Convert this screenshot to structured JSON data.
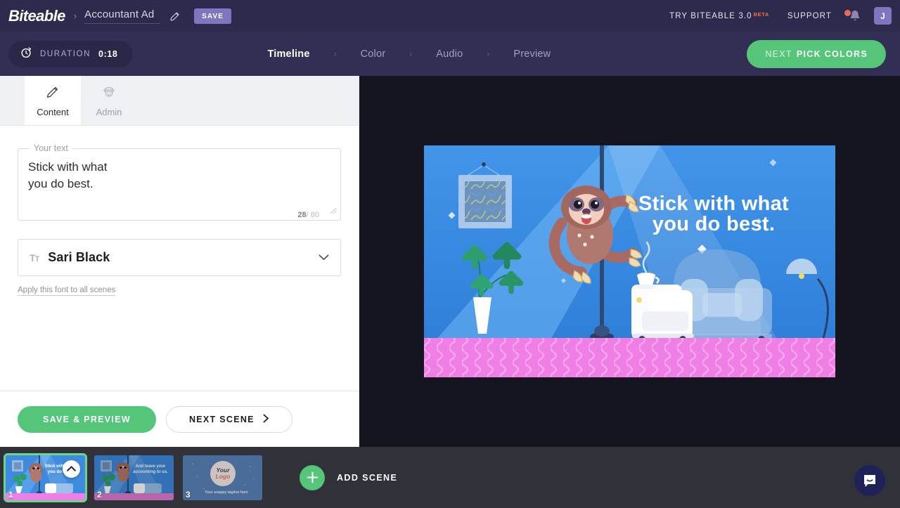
{
  "topbar": {
    "brand": "Biteable",
    "crumb_separator": "›",
    "project_name": "Accountant Ad",
    "edit_icon": "pencil-icon",
    "save_label": "SAVE",
    "try_label": "TRY BITEABLE 3.0",
    "beta_label": "BETA",
    "support_label": "SUPPORT",
    "bell_icon": "bell-icon",
    "avatar_initial": "J"
  },
  "navbar": {
    "timer_icon": "stopwatch-icon",
    "duration_label": "DURATION",
    "duration_value": "0:18",
    "steps": [
      {
        "label": "Timeline",
        "active": true
      },
      {
        "label": "Color",
        "active": false
      },
      {
        "label": "Audio",
        "active": false
      },
      {
        "label": "Preview",
        "active": false
      }
    ],
    "step_separator": "›",
    "next_button": {
      "prefix": "NEXT",
      "main": "PICK COLORS"
    }
  },
  "panel": {
    "tabs": [
      {
        "label": "Content",
        "icon": "pencil-icon",
        "active": true
      },
      {
        "label": "Admin",
        "icon": "admin-officer-icon",
        "active": false
      }
    ],
    "text_field": {
      "legend": "Your text",
      "value": "Stick with what\nyou do best.",
      "placeholder": "Your text",
      "count": "28",
      "count_max": "/ 80"
    },
    "font_select": {
      "icon": "text-format-icon",
      "value": "Sari Black",
      "chevron": "chevron-down-icon"
    },
    "apply_font_link": "Apply this font to all scenes",
    "footer": {
      "save_preview_label": "SAVE & PREVIEW",
      "next_scene_label": "NEXT SCENE",
      "next_scene_chevron": "chevron-right-icon"
    }
  },
  "stage": {
    "video": {
      "headline_line1": "Stick with what",
      "headline_line2": "you do best.",
      "scene_elements": [
        "sloth-character",
        "wall-picture-frame",
        "potted-plant",
        "armchair",
        "side-table",
        "coffee-cup",
        "floor-lamp",
        "pink-floor"
      ]
    }
  },
  "timeline": {
    "scenes": [
      {
        "number": "1",
        "selected": true,
        "caption_line1": "Stick with what",
        "caption_line2": "you do best."
      },
      {
        "number": "2",
        "selected": false,
        "caption_line1": "And leave your",
        "caption_line2": "accounting to us."
      },
      {
        "number": "3",
        "selected": false,
        "logo_line1": "Your",
        "logo_line2": "Logo",
        "tagline": "Your snappy tagline here"
      }
    ],
    "collapse_icon": "chevron-up-icon",
    "add_scene": {
      "icon": "plus-icon",
      "label": "ADD SCENE"
    },
    "intercom_icon": "intercom-chat-icon"
  },
  "colors": {
    "topbar_bg": "#2e2a4d",
    "navbar_bg": "#332e54",
    "accent_green": "#55c57a",
    "accent_purple": "#7f76bf",
    "beta_orange": "#f0723e",
    "stage_bg": "#15151f",
    "timeline_bg": "#313139",
    "video_blue": "#3d92e8",
    "video_floor_pink": "#ef7fe4",
    "intercom_blue": "#1f2159"
  }
}
